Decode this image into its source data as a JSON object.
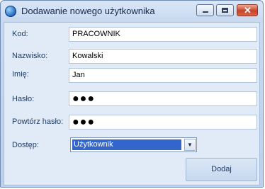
{
  "window": {
    "title": "Dodawanie nowego użytkownika",
    "icon": "app-globe-icon",
    "controls": {
      "minimize": "minimize-icon",
      "maximize": "maximize-icon",
      "close_glyph": "✕"
    }
  },
  "form": {
    "fields": {
      "kod": {
        "label": "Kod:",
        "value": "PRACOWNIK"
      },
      "nazwisko": {
        "label": "Nazwisko:",
        "value": "Kowalski"
      },
      "imie": {
        "label": "Imię:",
        "value": "Jan"
      },
      "haslo": {
        "label": "Hasło:",
        "value": "●●●"
      },
      "powtorz": {
        "label": "Powtórz hasło:",
        "value": "●●●"
      }
    },
    "dostep": {
      "label": "Dostęp:",
      "selected": "Użytkownik",
      "arrow": "▼"
    },
    "submit_label": "Dodaj"
  },
  "colors": {
    "selection": "#3366cc",
    "close_button": "#c9432a",
    "label_text": "#1f3d68"
  }
}
